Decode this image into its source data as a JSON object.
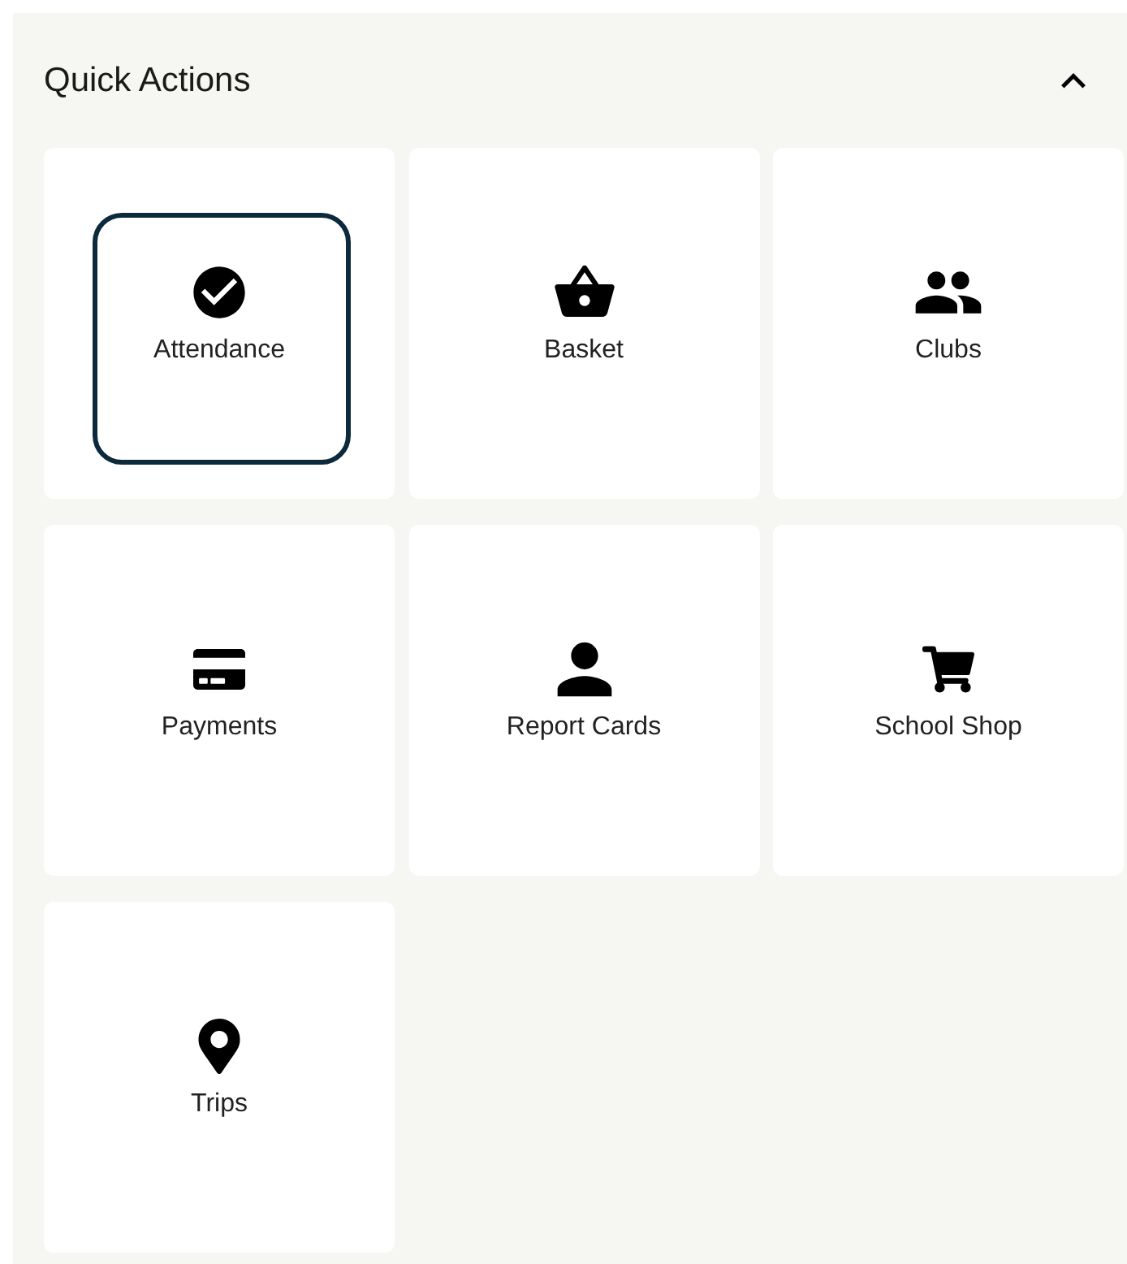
{
  "quick_actions": {
    "title": "Quick Actions",
    "expanded": true,
    "items": [
      {
        "label": "Attendance",
        "selected": true
      },
      {
        "label": "Basket",
        "selected": false
      },
      {
        "label": "Clubs",
        "selected": false
      },
      {
        "label": "Payments",
        "selected": false
      },
      {
        "label": "Report Cards",
        "selected": false
      },
      {
        "label": "School Shop",
        "selected": false
      },
      {
        "label": "Trips",
        "selected": false
      }
    ]
  }
}
